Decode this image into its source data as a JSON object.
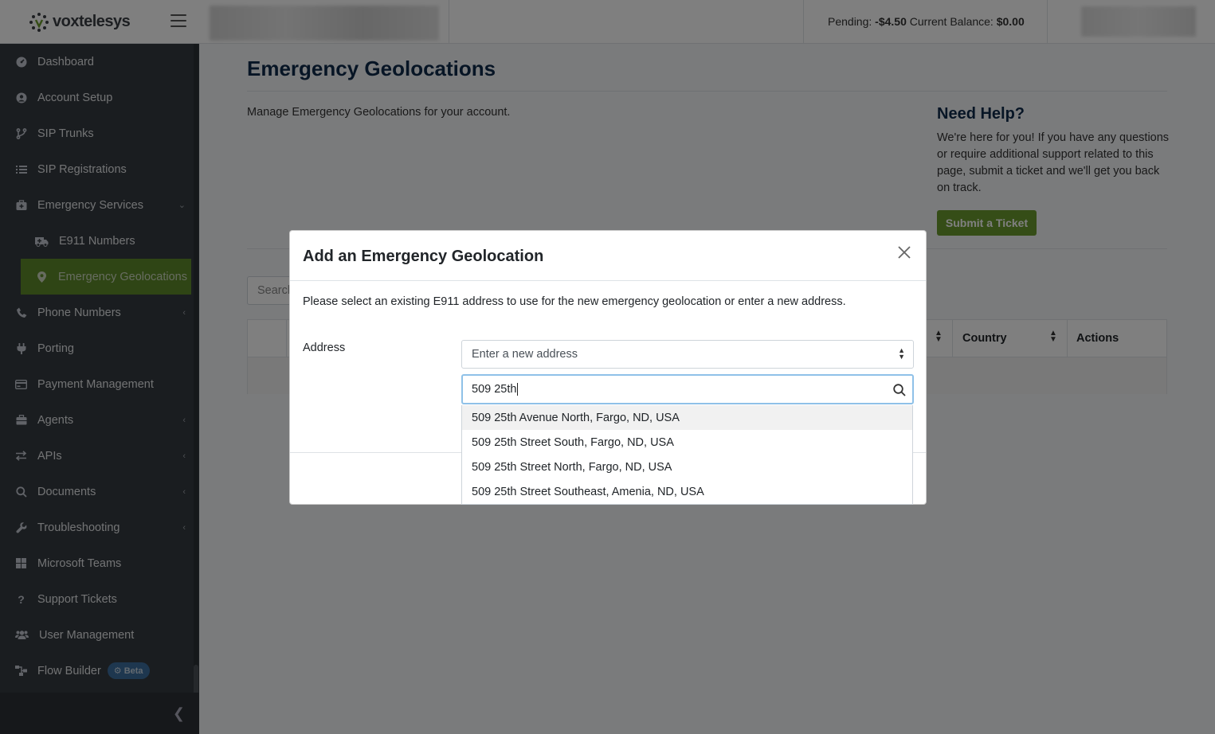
{
  "brand": {
    "name_part1": "vox",
    "name_part2": "telesys"
  },
  "header": {
    "pending_label": "Pending:",
    "pending_value": "-$4.50",
    "balance_label": "Current Balance:",
    "balance_value": "$0.00"
  },
  "sidebar": {
    "items": [
      {
        "label": "Dashboard",
        "icon": "dashboard-icon"
      },
      {
        "label": "Account Setup",
        "icon": "user-circle-icon"
      },
      {
        "label": "SIP Trunks",
        "icon": "branch-icon"
      },
      {
        "label": "SIP Registrations",
        "icon": "list-icon"
      },
      {
        "label": "Emergency Services",
        "icon": "medkit-icon"
      },
      {
        "label": "E911 Numbers",
        "icon": "ambulance-icon"
      },
      {
        "label": "Emergency Geolocations",
        "icon": "map-pin-icon"
      },
      {
        "label": "Phone Numbers",
        "icon": "phone-icon"
      },
      {
        "label": "Porting",
        "icon": "plug-icon"
      },
      {
        "label": "Payment Management",
        "icon": "credit-card-icon"
      },
      {
        "label": "Agents",
        "icon": "briefcase-icon"
      },
      {
        "label": "APIs",
        "icon": "exchange-icon"
      },
      {
        "label": "Documents",
        "icon": "search-icon"
      },
      {
        "label": "Troubleshooting",
        "icon": "wrench-icon"
      },
      {
        "label": "Microsoft Teams",
        "icon": "windows-icon"
      },
      {
        "label": "Support Tickets",
        "icon": "question-icon"
      },
      {
        "label": "User Management",
        "icon": "users-icon"
      },
      {
        "label": "Flow Builder",
        "icon": "sitemap-icon"
      }
    ],
    "beta_badge": "Beta"
  },
  "main": {
    "title": "Emergency Geolocations",
    "description": "Manage Emergency Geolocations for your account.",
    "search_placeholder": "Search",
    "table_headers": {
      "country": "Country",
      "actions": "Actions"
    }
  },
  "help": {
    "title": "Need Help?",
    "text": "We're here for you! If you have any questions or require additional support related to this page, submit a ticket and we'll get you back on track.",
    "button": "Submit a Ticket"
  },
  "modal": {
    "title": "Add an Emergency Geolocation",
    "intro": "Please select an existing E911 address to use for the new emergency geolocation or enter a new address.",
    "address_label": "Address",
    "address_select_value": "Enter a new address",
    "address_input_value": "509 25th",
    "suggestions": [
      "509 25th Avenue North, Fargo, ND, USA",
      "509 25th Street South, Fargo, ND, USA",
      "509 25th Street North, Fargo, ND, USA",
      "509 25th Street Southeast, Amenia, ND, USA"
    ]
  },
  "colors": {
    "accent_green": "#6b9a2f",
    "sidebar_bg": "#343a40",
    "title_navy": "#0f2a4a"
  }
}
